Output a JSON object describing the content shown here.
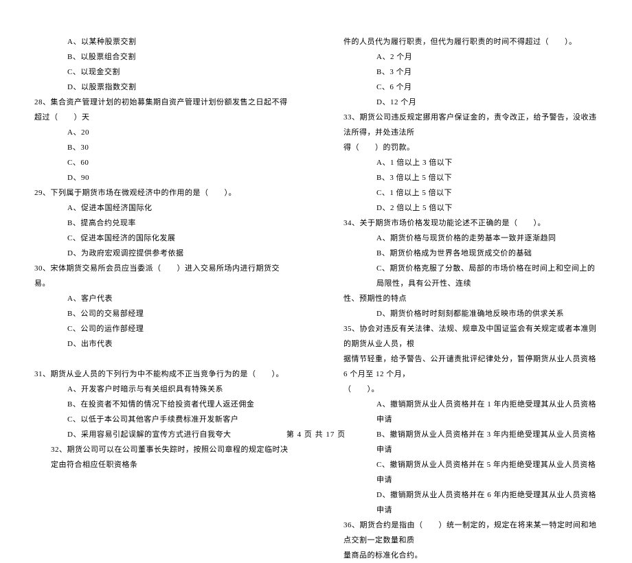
{
  "left": {
    "opts27": [
      "A、以某种股票交割",
      "B、以股票组合交割",
      "C、以现金交割",
      "D、以股票指数交割"
    ],
    "q28": "28、集合资产管理计划的初始募集期自资产管理计划份额发售之日起不得超过（　　）天",
    "opts28": [
      "A、20",
      "B、30",
      "C、60",
      "D、90"
    ],
    "q29": "29、下列属于期货市场在微观经济中的作用的是（　　）。",
    "opts29": [
      "A、促进本国经济国际化",
      "B、提高合约兑现率",
      "C、促进本国经济的国际化发展",
      "D、为政府宏观调控提供参考依据"
    ],
    "q30": "30、宋体期货交易所会员应当委派（　　）进入交易所场内进行期货交易。",
    "opts30": [
      "A、客户代表",
      "B、公司的交易部经理",
      "C、公司的运作部经理",
      "D、出市代表"
    ],
    "q31": "31、期货从业人员的下列行为中不能构成不正当竞争行为的是（　　）。",
    "opts31": [
      "A、开发客户时暗示与有关组织具有特殊关系",
      "B、在投资者不知情的情况下给投资者代理人返还佣金",
      "C、以低于本公司其他客户手续费标准开发新客户",
      "D、采用容易引起误解的宣传方式进行自我夸大"
    ],
    "q32": "32、期货公司可以在公司董事长失踪时，按照公司章程的规定临时决定由符合相应任职资格条"
  },
  "right": {
    "cont32": "件的人员代为履行职责，但代为履行职责的时间不得超过（　　）。",
    "opts32": [
      "A、2 个月",
      "B、3 个月",
      "C、6 个月",
      "D、12 个月"
    ],
    "q33a": "33、期货公司违反规定挪用客户保证金的，责令改正，给予警告，没收违法所得，并处违法所",
    "q33b": "得（　　）的罚款。",
    "opts33": [
      "A、1 倍以上 3 倍以下",
      "B、3 倍以上 5 倍以下",
      "C、1 倍以上 5 倍以下",
      "D、2 倍以上 5 倍以下"
    ],
    "q34": "34、关于期货市场价格发现功能论述不正确的是（　　）。",
    "opts34a": [
      "A、期货价格与现货价格的走势基本一致并逐渐趋同",
      "B、期货价格成为世界各地现货成交价的基础"
    ],
    "opt34c1": "C、期货价格克服了分散、局部的市场价格在时间上和空间上的局限性，具有公开性、连续",
    "opt34c2": "性、预期性的特点",
    "opts34d": [
      "D、期货价格时时刻刻都能准确地反映市场的供求关系"
    ],
    "q35a": "35、协会对违反有关法律、法规、规章及中国证监会有关规定或者本准则的期货从业人员，根",
    "q35b": "据情节轻重，给予警告、公开谴责批评纪律处分，暂停期货从业人员资格 6 个月至 12 个月，",
    "q35c": "（　　）。",
    "opts35": [
      "A、撤销期货从业人员资格并在 1 年内拒绝受理其从业人员资格申请",
      "B、撤销期货从业人员资格并在 3 年内拒绝受理其从业人员资格申请",
      "C、撤销期货从业人员资格并在 5 年内拒绝受理其从业人员资格申请",
      "D、撤销期货从业人员资格并在 6 年内拒绝受理其从业人员资格申请"
    ],
    "q36a": "36、期货合约是指由（　　）统一制定的，规定在将来某一特定时间和地点交割一定数量和质",
    "q36b": "量商品的标准化合约。"
  },
  "footer": "第 4 页 共 17 页"
}
